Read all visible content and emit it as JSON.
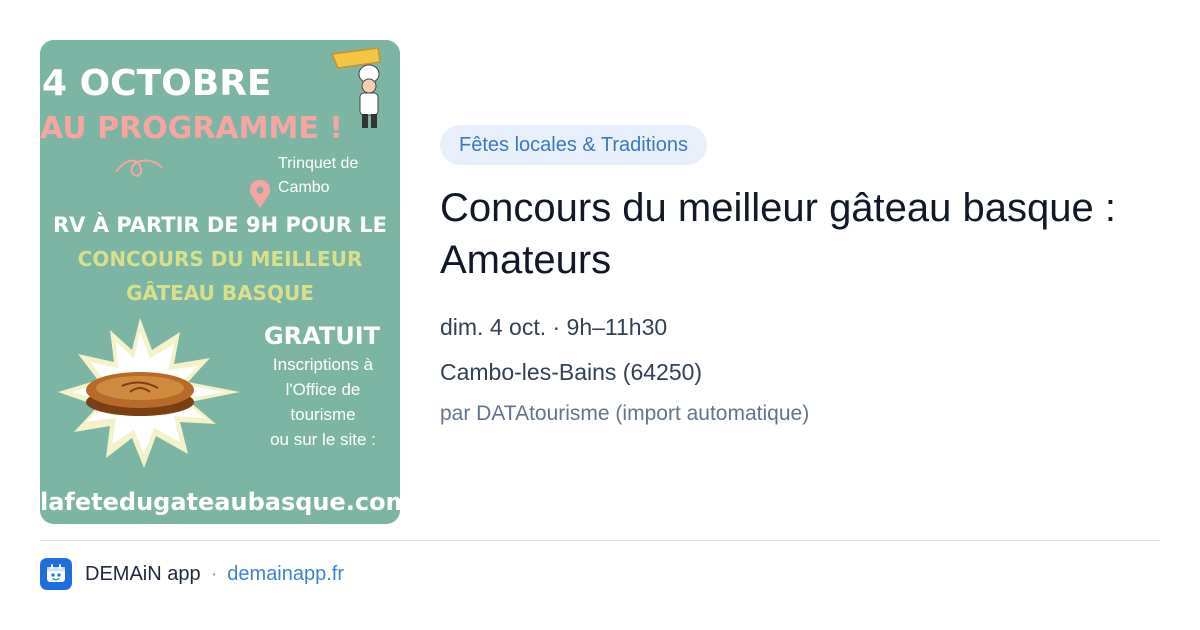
{
  "poster": {
    "date_line": "4 OCTOBRE",
    "program_line": "AU PROGRAMME !",
    "location_line1": "Trinquet de",
    "location_line2": "Cambo",
    "rv_line": "RV À PARTIR DE 9H POUR LE",
    "contest_line1": "CONCOURS DU MEILLEUR",
    "contest_line2": "GÂTEAU BASQUE",
    "free_label": "GRATUIT",
    "signup_line1": "Inscriptions à",
    "signup_line2": "l'Office de",
    "signup_line3": "tourisme",
    "signup_line4": "ou sur le site :",
    "website": "lafetedugateaubasque.com",
    "colors": {
      "background": "#7cb5a3",
      "white": "#ffffff",
      "pink": "#f6a5a0",
      "yellow": "#d8e08a"
    }
  },
  "event": {
    "category": "Fêtes locales & Traditions",
    "title": "Concours du meilleur gâteau basque : Amateurs",
    "datetime": "dim. 4 oct. · 9h–11h30",
    "location": "Cambo-les-Bains (64250)",
    "source": "par DATAtourisme (import automatique)"
  },
  "footer": {
    "app_name": "DEMAiN app",
    "separator": "·",
    "domain": "demainapp.fr",
    "icon": "app-logo-icon"
  }
}
